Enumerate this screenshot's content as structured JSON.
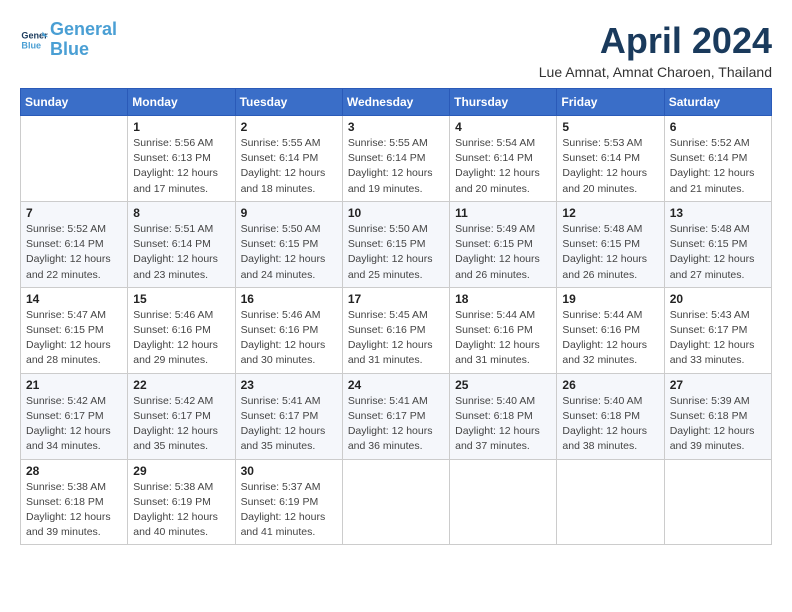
{
  "header": {
    "logo_line1": "General",
    "logo_line2": "Blue",
    "month_title": "April 2024",
    "subtitle": "Lue Amnat, Amnat Charoen, Thailand"
  },
  "weekdays": [
    "Sunday",
    "Monday",
    "Tuesday",
    "Wednesday",
    "Thursday",
    "Friday",
    "Saturday"
  ],
  "weeks": [
    [
      {
        "day": "",
        "info": ""
      },
      {
        "day": "1",
        "info": "Sunrise: 5:56 AM\nSunset: 6:13 PM\nDaylight: 12 hours\nand 17 minutes."
      },
      {
        "day": "2",
        "info": "Sunrise: 5:55 AM\nSunset: 6:14 PM\nDaylight: 12 hours\nand 18 minutes."
      },
      {
        "day": "3",
        "info": "Sunrise: 5:55 AM\nSunset: 6:14 PM\nDaylight: 12 hours\nand 19 minutes."
      },
      {
        "day": "4",
        "info": "Sunrise: 5:54 AM\nSunset: 6:14 PM\nDaylight: 12 hours\nand 20 minutes."
      },
      {
        "day": "5",
        "info": "Sunrise: 5:53 AM\nSunset: 6:14 PM\nDaylight: 12 hours\nand 20 minutes."
      },
      {
        "day": "6",
        "info": "Sunrise: 5:52 AM\nSunset: 6:14 PM\nDaylight: 12 hours\nand 21 minutes."
      }
    ],
    [
      {
        "day": "7",
        "info": "Sunrise: 5:52 AM\nSunset: 6:14 PM\nDaylight: 12 hours\nand 22 minutes."
      },
      {
        "day": "8",
        "info": "Sunrise: 5:51 AM\nSunset: 6:14 PM\nDaylight: 12 hours\nand 23 minutes."
      },
      {
        "day": "9",
        "info": "Sunrise: 5:50 AM\nSunset: 6:15 PM\nDaylight: 12 hours\nand 24 minutes."
      },
      {
        "day": "10",
        "info": "Sunrise: 5:50 AM\nSunset: 6:15 PM\nDaylight: 12 hours\nand 25 minutes."
      },
      {
        "day": "11",
        "info": "Sunrise: 5:49 AM\nSunset: 6:15 PM\nDaylight: 12 hours\nand 26 minutes."
      },
      {
        "day": "12",
        "info": "Sunrise: 5:48 AM\nSunset: 6:15 PM\nDaylight: 12 hours\nand 26 minutes."
      },
      {
        "day": "13",
        "info": "Sunrise: 5:48 AM\nSunset: 6:15 PM\nDaylight: 12 hours\nand 27 minutes."
      }
    ],
    [
      {
        "day": "14",
        "info": "Sunrise: 5:47 AM\nSunset: 6:15 PM\nDaylight: 12 hours\nand 28 minutes."
      },
      {
        "day": "15",
        "info": "Sunrise: 5:46 AM\nSunset: 6:16 PM\nDaylight: 12 hours\nand 29 minutes."
      },
      {
        "day": "16",
        "info": "Sunrise: 5:46 AM\nSunset: 6:16 PM\nDaylight: 12 hours\nand 30 minutes."
      },
      {
        "day": "17",
        "info": "Sunrise: 5:45 AM\nSunset: 6:16 PM\nDaylight: 12 hours\nand 31 minutes."
      },
      {
        "day": "18",
        "info": "Sunrise: 5:44 AM\nSunset: 6:16 PM\nDaylight: 12 hours\nand 31 minutes."
      },
      {
        "day": "19",
        "info": "Sunrise: 5:44 AM\nSunset: 6:16 PM\nDaylight: 12 hours\nand 32 minutes."
      },
      {
        "day": "20",
        "info": "Sunrise: 5:43 AM\nSunset: 6:17 PM\nDaylight: 12 hours\nand 33 minutes."
      }
    ],
    [
      {
        "day": "21",
        "info": "Sunrise: 5:42 AM\nSunset: 6:17 PM\nDaylight: 12 hours\nand 34 minutes."
      },
      {
        "day": "22",
        "info": "Sunrise: 5:42 AM\nSunset: 6:17 PM\nDaylight: 12 hours\nand 35 minutes."
      },
      {
        "day": "23",
        "info": "Sunrise: 5:41 AM\nSunset: 6:17 PM\nDaylight: 12 hours\nand 35 minutes."
      },
      {
        "day": "24",
        "info": "Sunrise: 5:41 AM\nSunset: 6:17 PM\nDaylight: 12 hours\nand 36 minutes."
      },
      {
        "day": "25",
        "info": "Sunrise: 5:40 AM\nSunset: 6:18 PM\nDaylight: 12 hours\nand 37 minutes."
      },
      {
        "day": "26",
        "info": "Sunrise: 5:40 AM\nSunset: 6:18 PM\nDaylight: 12 hours\nand 38 minutes."
      },
      {
        "day": "27",
        "info": "Sunrise: 5:39 AM\nSunset: 6:18 PM\nDaylight: 12 hours\nand 39 minutes."
      }
    ],
    [
      {
        "day": "28",
        "info": "Sunrise: 5:38 AM\nSunset: 6:18 PM\nDaylight: 12 hours\nand 39 minutes."
      },
      {
        "day": "29",
        "info": "Sunrise: 5:38 AM\nSunset: 6:19 PM\nDaylight: 12 hours\nand 40 minutes."
      },
      {
        "day": "30",
        "info": "Sunrise: 5:37 AM\nSunset: 6:19 PM\nDaylight: 12 hours\nand 41 minutes."
      },
      {
        "day": "",
        "info": ""
      },
      {
        "day": "",
        "info": ""
      },
      {
        "day": "",
        "info": ""
      },
      {
        "day": "",
        "info": ""
      }
    ]
  ]
}
